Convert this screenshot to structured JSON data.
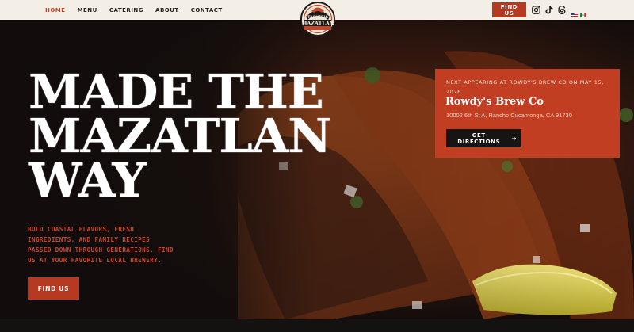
{
  "nav": {
    "items": [
      {
        "label": "HOME",
        "active": true
      },
      {
        "label": "MENU",
        "active": false
      },
      {
        "label": "CATERING",
        "active": false
      },
      {
        "label": "ABOUT",
        "active": false
      },
      {
        "label": "CONTACT",
        "active": false
      }
    ],
    "find_us_label": "FIND US"
  },
  "logo": {
    "text_top": "TAQUERIA",
    "text_main": "MAZATLAN"
  },
  "social_icons": [
    "instagram-icon",
    "tiktok-icon",
    "threads-icon"
  ],
  "language_flags": [
    "us-flag-icon",
    "mexico-flag-icon"
  ],
  "hero": {
    "headline_line1": "MADE THE",
    "headline_line2": "MAZATLAN",
    "headline_line3": "WAY",
    "subtext": "BOLD COASTAL FLAVORS, FRESH INGREDIENTS, AND FAMILY RECIPES PASSED DOWN THROUGH GENERATIONS. FIND US AT YOUR FAVORITE LOCAL BREWERY.",
    "cta_label": "FIND US"
  },
  "location_card": {
    "eyebrow": "NEXT APPEARING AT ROWDY'S BREW CO ON MAY 15, 2026.",
    "venue": "Rowdy's Brew Co",
    "address": "10002 6th St A, Rancho Cucamonga, CA 91730",
    "directions_label": "GET DIRECTIONS",
    "directions_arrow": "→"
  },
  "colors": {
    "accent": "#b63a22",
    "card": "#c13e22",
    "topbar": "#f4efe6",
    "dark": "#141010"
  }
}
